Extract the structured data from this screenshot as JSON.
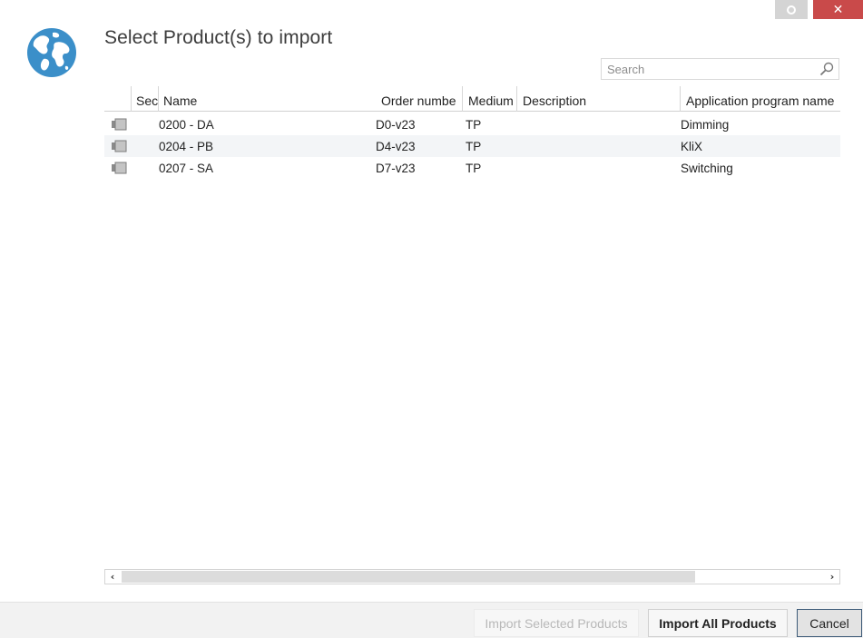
{
  "window": {
    "title": "Select Product(s) to import",
    "restore_icon": "restore-icon",
    "close_symbol": "✕"
  },
  "search": {
    "placeholder": "Search",
    "value": ""
  },
  "grid": {
    "columns": [
      "Sec",
      "Name",
      "Order numbe",
      "Medium",
      "Description",
      "Application program name"
    ],
    "rows": [
      {
        "name": "0200 - DA",
        "order_number": "D0-v23",
        "medium": "TP",
        "description": "",
        "application_program": "Dimming"
      },
      {
        "name": "0204 - PB",
        "order_number": "D4-v23",
        "medium": "TP",
        "description": "",
        "application_program": "KliX"
      },
      {
        "name": "0207 - SA",
        "order_number": "D7-v23",
        "medium": "TP",
        "description": "",
        "application_program": "Switching"
      }
    ]
  },
  "scrollbar": {
    "left_arrow": "‹",
    "right_arrow": "›"
  },
  "buttons": {
    "import_selected": "Import Selected Products",
    "import_all": "Import All Products",
    "cancel": "Cancel"
  },
  "colors": {
    "close_button": "#c94a4a",
    "globe": "#3b8fc9",
    "cancel_border": "#3c5a78"
  }
}
